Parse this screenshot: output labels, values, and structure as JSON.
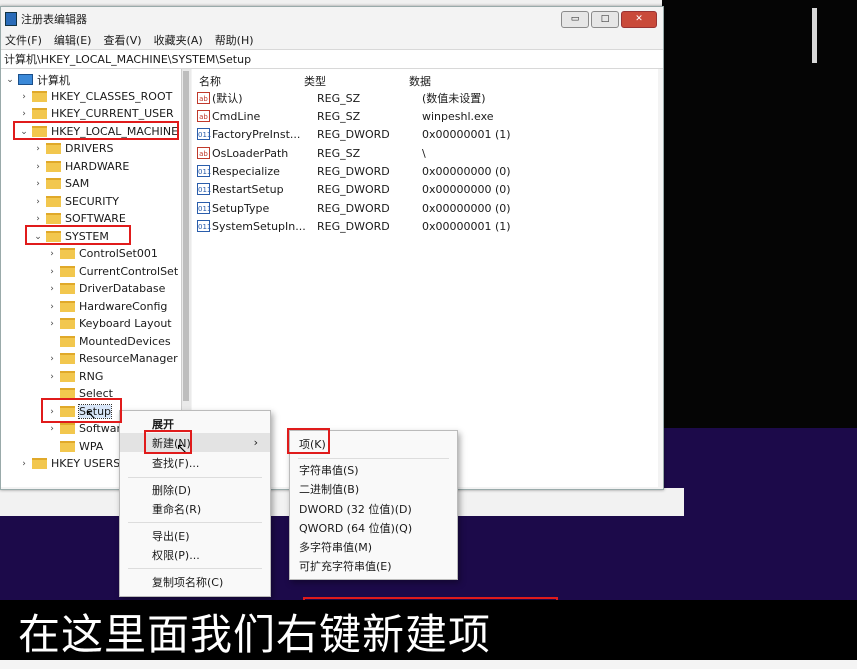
{
  "window": {
    "title": "注册表编辑器",
    "controls": {
      "minimize": "▭",
      "maximize": "□",
      "close": "✕"
    }
  },
  "menu": [
    "文件(F)",
    "编辑(E)",
    "查看(V)",
    "收藏夹(A)",
    "帮助(H)"
  ],
  "address": "计算机\\HKEY_LOCAL_MACHINE\\SYSTEM\\Setup",
  "tree": {
    "root": "计算机",
    "items": [
      "HKEY_CLASSES_ROOT",
      "HKEY_CURRENT_USER",
      "HKEY_LOCAL_MACHINE",
      "DRIVERS",
      "HARDWARE",
      "SAM",
      "SECURITY",
      "SOFTWARE",
      "SYSTEM",
      "ControlSet001",
      "CurrentControlSet",
      "DriverDatabase",
      "HardwareConfig",
      "Keyboard Layout",
      "MountedDevices",
      "ResourceManager",
      "RNG",
      "Select",
      "Setup",
      "Software",
      "WPA",
      "HKEY USERS"
    ]
  },
  "list": {
    "headers": [
      "名称",
      "类型",
      "数据"
    ],
    "rows": [
      {
        "icon": "ab",
        "name": "(默认)",
        "type": "REG_SZ",
        "data": "(数值未设置)"
      },
      {
        "icon": "ab",
        "name": "CmdLine",
        "type": "REG_SZ",
        "data": "winpeshl.exe"
      },
      {
        "icon": "011",
        "name": "FactoryPreInst...",
        "type": "REG_DWORD",
        "data": "0x00000001 (1)"
      },
      {
        "icon": "ab",
        "name": "OsLoaderPath",
        "type": "REG_SZ",
        "data": "\\"
      },
      {
        "icon": "011",
        "name": "Respecialize",
        "type": "REG_DWORD",
        "data": "0x00000000 (0)"
      },
      {
        "icon": "011",
        "name": "RestartSetup",
        "type": "REG_DWORD",
        "data": "0x00000000 (0)"
      },
      {
        "icon": "011",
        "name": "SetupType",
        "type": "REG_DWORD",
        "data": "0x00000000 (0)"
      },
      {
        "icon": "011",
        "name": "SystemSetupIn...",
        "type": "REG_DWORD",
        "data": "0x00000001 (1)"
      }
    ]
  },
  "context_menu": {
    "expand": "展开",
    "new": "新建(N)",
    "new_arrow": "›",
    "find": "查找(F)...",
    "delete": "删除(D)",
    "rename": "重命名(R)",
    "export": "导出(E)",
    "permissions": "权限(P)...",
    "copy_key_name": "复制项名称(C)"
  },
  "submenu": {
    "key": "项(K)",
    "string": "字符串值(S)",
    "binary": "二进制值(B)",
    "dword": "DWORD (32 位值)(D)",
    "qword": "QWORD (64 位值)(Q)",
    "multi_string": "多字符串值(M)",
    "expandable_string": "可扩充字符串值(E)"
  },
  "caption": {
    "part1": "在这里面我们",
    "part2": "右键新建项"
  }
}
